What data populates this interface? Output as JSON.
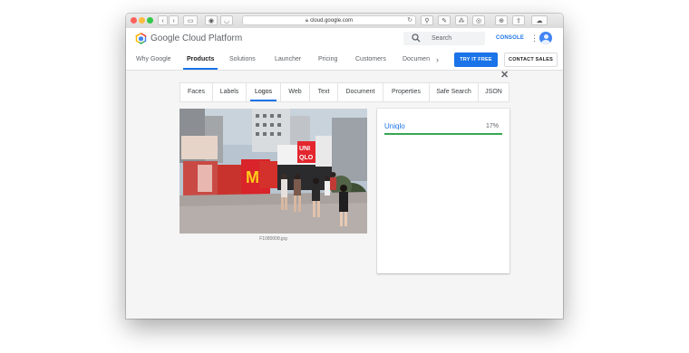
{
  "browser": {
    "url": "cloud.google.com"
  },
  "header": {
    "brand": "Google Cloud Platform",
    "search_placeholder": "Search",
    "console_label": "CONSOLE"
  },
  "nav": {
    "items": [
      "Why Google",
      "Products",
      "Solutions",
      "Launcher",
      "Pricing",
      "Customers",
      "Documen"
    ],
    "active": "Products",
    "try_label": "TRY IT FREE",
    "contact_label": "CONTACT SALES"
  },
  "vision": {
    "tabs": [
      "Faces",
      "Labels",
      "Logos",
      "Web",
      "Text",
      "Document",
      "Properties",
      "Safe Search",
      "JSON"
    ],
    "active_tab": "Logos",
    "image_caption": "F1080008.jpg",
    "results": [
      {
        "name": "Uniqlo",
        "score_label": "17%",
        "score": 0.17
      }
    ]
  },
  "colors": {
    "accent": "#1a73e8",
    "result_bar": "#34a853"
  }
}
